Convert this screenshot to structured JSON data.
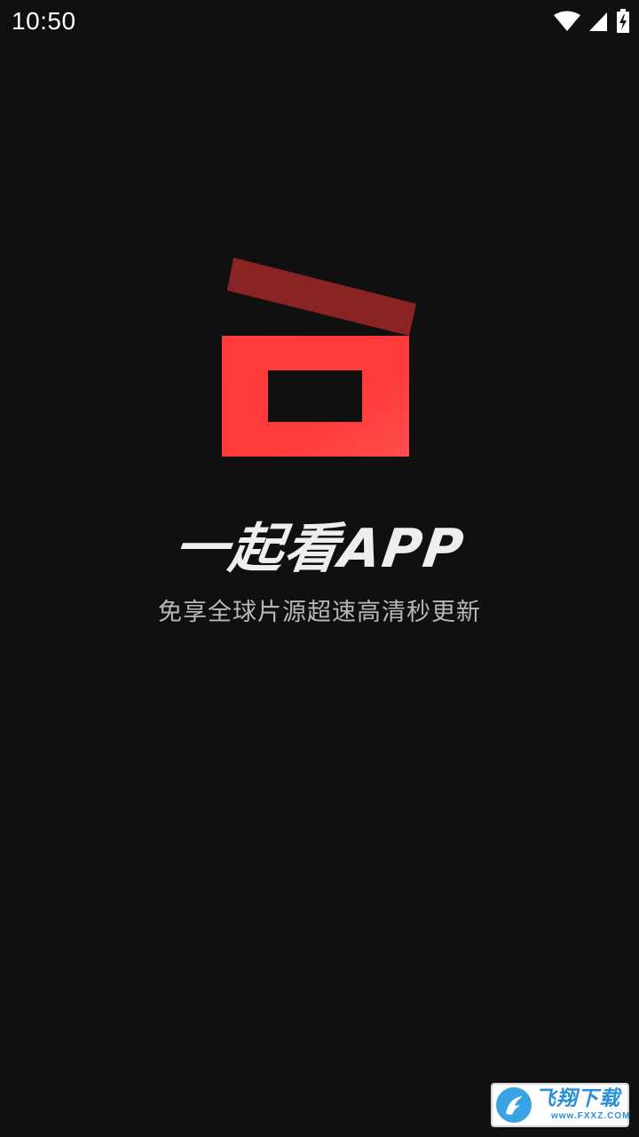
{
  "status_bar": {
    "time": "10:50",
    "icons": [
      "wifi-icon",
      "cellular-signal-icon",
      "battery-charging-icon"
    ]
  },
  "splash": {
    "logo": "clapperboard-logo",
    "title": "一起看APP",
    "subtitle": "免享全球片源超速高清秒更新"
  },
  "colors": {
    "background": "#101010",
    "logo_red": "#ff3b3b",
    "logo_dark_red": "#8a2324"
  },
  "watermark": {
    "name": "飞翔下载",
    "url": "www.FXXZ.COM"
  }
}
